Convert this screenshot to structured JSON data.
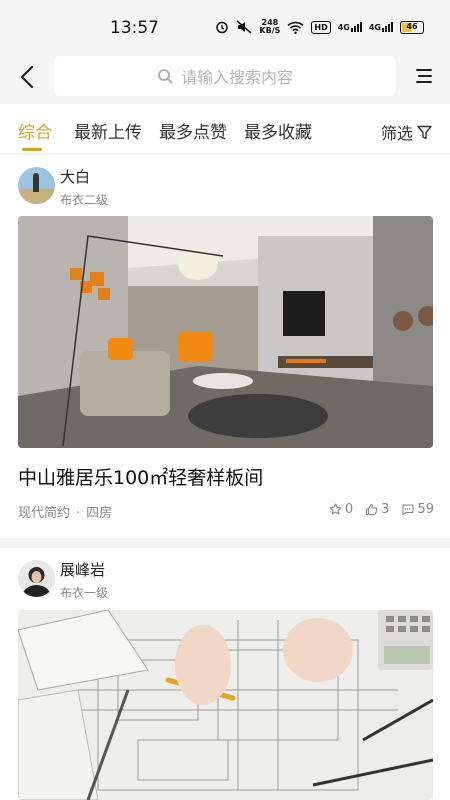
{
  "status": {
    "time": "13:57",
    "net_speed": "248",
    "net_unit": "KB/S",
    "hd": "HD",
    "sig1": "4G",
    "sig2": "4G",
    "battery": "46"
  },
  "search": {
    "placeholder": "请输入搜索内容"
  },
  "tabs": [
    {
      "label": "综合",
      "active": true
    },
    {
      "label": "最新上传"
    },
    {
      "label": "最多点赞"
    },
    {
      "label": "最多收藏"
    }
  ],
  "filter_label": "筛选",
  "colors": {
    "accent": "#d7a132"
  },
  "posts": [
    {
      "author": "大白",
      "level": "布衣二级",
      "title": "中山雅居乐100㎡轻奢样板间",
      "style": "现代简约",
      "rooms": "四房",
      "stars": "0",
      "likes": "3",
      "comments": "59"
    },
    {
      "author": "展峰岩",
      "level": "布衣一级"
    }
  ]
}
